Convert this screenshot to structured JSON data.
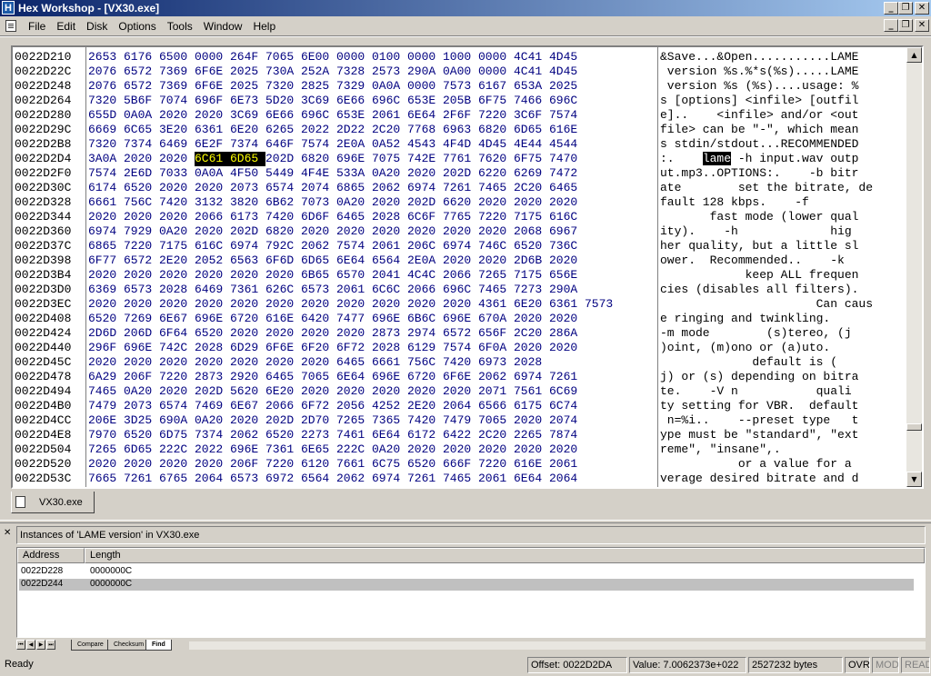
{
  "window": {
    "title": "Hex Workshop - [VX30.exe]",
    "app_icon": "H"
  },
  "menu": [
    "File",
    "Edit",
    "Disk",
    "Options",
    "Tools",
    "Window",
    "Help"
  ],
  "hex_view": {
    "rows": [
      {
        "addr": "0022D210",
        "hex": [
          "2653",
          "6176",
          "6500",
          "0000",
          "264F",
          "7065",
          "6E00",
          "0000",
          "0100",
          "0000",
          "1000",
          "0000",
          "4C41",
          "4D45"
        ],
        "ascii": "&Save...&Open...........LAME"
      },
      {
        "addr": "0022D22C",
        "hex": [
          "2076",
          "6572",
          "7369",
          "6F6E",
          "2025",
          "730A",
          "252A",
          "7328",
          "2573",
          "290A",
          "0A00",
          "0000",
          "4C41",
          "4D45"
        ],
        "ascii": " version %s.%*s(%s).....LAME"
      },
      {
        "addr": "0022D248",
        "hex": [
          "2076",
          "6572",
          "7369",
          "6F6E",
          "2025",
          "7320",
          "2825",
          "7329",
          "0A0A",
          "0000",
          "7573",
          "6167",
          "653A",
          "2025"
        ],
        "ascii": " version %s (%s)....usage: %"
      },
      {
        "addr": "0022D264",
        "hex": [
          "7320",
          "5B6F",
          "7074",
          "696F",
          "6E73",
          "5D20",
          "3C69",
          "6E66",
          "696C",
          "653E",
          "205B",
          "6F75",
          "7466",
          "696C"
        ],
        "ascii": "s [options] <infile> [outfil"
      },
      {
        "addr": "0022D280",
        "hex": [
          "655D",
          "0A0A",
          "2020",
          "2020",
          "3C69",
          "6E66",
          "696C",
          "653E",
          "2061",
          "6E64",
          "2F6F",
          "7220",
          "3C6F",
          "7574"
        ],
        "ascii": "e]..    <infile> and/or <out"
      },
      {
        "addr": "0022D29C",
        "hex": [
          "6669",
          "6C65",
          "3E20",
          "6361",
          "6E20",
          "6265",
          "2022",
          "2D22",
          "2C20",
          "7768",
          "6963",
          "6820",
          "6D65",
          "616E"
        ],
        "ascii": "file> can be \"-\", which mean"
      },
      {
        "addr": "0022D2B8",
        "hex": [
          "7320",
          "7374",
          "6469",
          "6E2F",
          "7374",
          "646F",
          "7574",
          "2E0A",
          "0A52",
          "4543",
          "4F4D",
          "4D45",
          "4E44",
          "4544"
        ],
        "ascii": "s stdin/stdout...RECOMMENDED"
      },
      {
        "addr": "0022D2D4",
        "hex": [
          "3A0A",
          "2020",
          "2020",
          "6C61",
          "6D65",
          "202D",
          "6820",
          "696E",
          "7075",
          "742E",
          "7761",
          "7620",
          "6F75",
          "7470"
        ],
        "ascii_pre": ":.    ",
        "ascii_sel": "lame",
        "ascii_post": " -h input.wav outp",
        "sel_words": [
          3,
          4
        ]
      },
      {
        "addr": "0022D2F0",
        "hex": [
          "7574",
          "2E6D",
          "7033",
          "0A0A",
          "4F50",
          "5449",
          "4F4E",
          "533A",
          "0A20",
          "2020",
          "202D",
          "6220",
          "6269",
          "7472"
        ],
        "ascii": "ut.mp3..OPTIONS:.    -b bitr"
      },
      {
        "addr": "0022D30C",
        "hex": [
          "6174",
          "6520",
          "2020",
          "2020",
          "2073",
          "6574",
          "2074",
          "6865",
          "2062",
          "6974",
          "7261",
          "7465",
          "2C20",
          "6465"
        ],
        "ascii": "ate        set the bitrate, de"
      },
      {
        "addr": "0022D328",
        "hex": [
          "6661",
          "756C",
          "7420",
          "3132",
          "3820",
          "6B62",
          "7073",
          "0A20",
          "2020",
          "202D",
          "6620",
          "2020",
          "2020",
          "2020"
        ],
        "ascii": "fault 128 kbps.    -f      "
      },
      {
        "addr": "0022D344",
        "hex": [
          "2020",
          "2020",
          "2020",
          "2066",
          "6173",
          "7420",
          "6D6F",
          "6465",
          "2028",
          "6C6F",
          "7765",
          "7220",
          "7175",
          "616C"
        ],
        "ascii": "       fast mode (lower qual"
      },
      {
        "addr": "0022D360",
        "hex": [
          "6974",
          "7929",
          "0A20",
          "2020",
          "202D",
          "6820",
          "2020",
          "2020",
          "2020",
          "2020",
          "2020",
          "2020",
          "2068",
          "6967"
        ],
        "ascii": "ity).    -h             hig"
      },
      {
        "addr": "0022D37C",
        "hex": [
          "6865",
          "7220",
          "7175",
          "616C",
          "6974",
          "792C",
          "2062",
          "7574",
          "2061",
          "206C",
          "6974",
          "746C",
          "6520",
          "736C"
        ],
        "ascii": "her quality, but a little sl"
      },
      {
        "addr": "0022D398",
        "hex": [
          "6F77",
          "6572",
          "2E20",
          "2052",
          "6563",
          "6F6D",
          "6D65",
          "6E64",
          "6564",
          "2E0A",
          "2020",
          "2020",
          "2D6B",
          "2020"
        ],
        "ascii": "ower.  Recommended..    -k  "
      },
      {
        "addr": "0022D3B4",
        "hex": [
          "2020",
          "2020",
          "2020",
          "2020",
          "2020",
          "2020",
          "6B65",
          "6570",
          "2041",
          "4C4C",
          "2066",
          "7265",
          "7175",
          "656E"
        ],
        "ascii": "            keep ALL frequen"
      },
      {
        "addr": "0022D3D0",
        "hex": [
          "6369",
          "6573",
          "2028",
          "6469",
          "7361",
          "626C",
          "6573",
          "2061",
          "6C6C",
          "2066",
          "696C",
          "7465",
          "7273",
          "290A"
        ],
        "ascii": "cies (disables all filters)."
      },
      {
        "addr": "0022D3EC",
        "hex": [
          "2020",
          "2020",
          "2020",
          "2020",
          "2020",
          "2020",
          "2020",
          "2020",
          "2020",
          "2020",
          "2020",
          "4361",
          "6E20",
          "6361",
          "7573"
        ],
        "ascii": "                      Can caus"
      },
      {
        "addr": "0022D408",
        "hex": [
          "6520",
          "7269",
          "6E67",
          "696E",
          "6720",
          "616E",
          "6420",
          "7477",
          "696E",
          "6B6C",
          "696E",
          "670A",
          "2020",
          "2020"
        ],
        "ascii": "e ringing and twinkling.    "
      },
      {
        "addr": "0022D424",
        "hex": [
          "2D6D",
          "206D",
          "6F64",
          "6520",
          "2020",
          "2020",
          "2020",
          "2020",
          "2873",
          "2974",
          "6572",
          "656F",
          "2C20",
          "286A"
        ],
        "ascii": "-m mode        (s)tereo, (j"
      },
      {
        "addr": "0022D440",
        "hex": [
          "296F",
          "696E",
          "742C",
          "2028",
          "6D29",
          "6F6E",
          "6F20",
          "6F72",
          "2028",
          "6129",
          "7574",
          "6F0A",
          "2020",
          "2020"
        ],
        "ascii": ")oint, (m)ono or (a)uto.    "
      },
      {
        "addr": "0022D45C",
        "hex": [
          "2020",
          "2020",
          "2020",
          "2020",
          "2020",
          "2020",
          "2020",
          "6465",
          "6661",
          "756C",
          "7420",
          "6973",
          "2028"
        ],
        "ascii": "             default is ("
      },
      {
        "addr": "0022D478",
        "hex": [
          "6A29",
          "206F",
          "7220",
          "2873",
          "2920",
          "6465",
          "7065",
          "6E64",
          "696E",
          "6720",
          "6F6E",
          "2062",
          "6974",
          "7261"
        ],
        "ascii": "j) or (s) depending on bitra"
      },
      {
        "addr": "0022D494",
        "hex": [
          "7465",
          "0A20",
          "2020",
          "202D",
          "5620",
          "6E20",
          "2020",
          "2020",
          "2020",
          "2020",
          "2020",
          "2071",
          "7561",
          "6C69"
        ],
        "ascii": "te.    -V n           quali"
      },
      {
        "addr": "0022D4B0",
        "hex": [
          "7479",
          "2073",
          "6574",
          "7469",
          "6E67",
          "2066",
          "6F72",
          "2056",
          "4252",
          "2E20",
          "2064",
          "6566",
          "6175",
          "6C74"
        ],
        "ascii": "ty setting for VBR.  default"
      },
      {
        "addr": "0022D4CC",
        "hex": [
          "206E",
          "3D25",
          "690A",
          "0A20",
          "2020",
          "202D",
          "2D70",
          "7265",
          "7365",
          "7420",
          "7479",
          "7065",
          "2020",
          "2074"
        ],
        "ascii": " n=%i..    --preset type   t"
      },
      {
        "addr": "0022D4E8",
        "hex": [
          "7970",
          "6520",
          "6D75",
          "7374",
          "2062",
          "6520",
          "2273",
          "7461",
          "6E64",
          "6172",
          "6422",
          "2C20",
          "2265",
          "7874"
        ],
        "ascii": "ype must be \"standard\", \"ext"
      },
      {
        "addr": "0022D504",
        "hex": [
          "7265",
          "6D65",
          "222C",
          "2022",
          "696E",
          "7361",
          "6E65",
          "222C",
          "0A20",
          "2020",
          "2020",
          "2020",
          "2020",
          "2020"
        ],
        "ascii": "reme\", \"insane\",.           "
      },
      {
        "addr": "0022D520",
        "hex": [
          "2020",
          "2020",
          "2020",
          "2020",
          "206F",
          "7220",
          "6120",
          "7661",
          "6C75",
          "6520",
          "666F",
          "7220",
          "616E",
          "2061"
        ],
        "ascii": "           or a value for a"
      },
      {
        "addr": "0022D53C",
        "hex": [
          "7665",
          "7261",
          "6765",
          "2064",
          "6573",
          "6972",
          "6564",
          "2062",
          "6974",
          "7261",
          "7465",
          "2061",
          "6E64",
          "2064"
        ],
        "ascii": "verage desired bitrate and d"
      }
    ]
  },
  "doc_tab": {
    "label": "VX30.exe"
  },
  "results": {
    "caption": "Instances of 'LAME version' in VX30.exe",
    "columns": [
      "Address",
      "Length"
    ],
    "rows": [
      {
        "address": "0022D228",
        "length": "0000000C"
      },
      {
        "address": "0022D244",
        "length": "0000000C"
      }
    ],
    "tabs": [
      "Compare",
      "Checksum",
      "Find"
    ],
    "active_tab": "Find"
  },
  "status": {
    "ready": "Ready",
    "offset": "Offset: 0022D2DA",
    "value": "Value: 7.0062373e+022",
    "size": "2527232 bytes",
    "ovr": "OVR",
    "mod": "MOD",
    "read": "READ"
  }
}
